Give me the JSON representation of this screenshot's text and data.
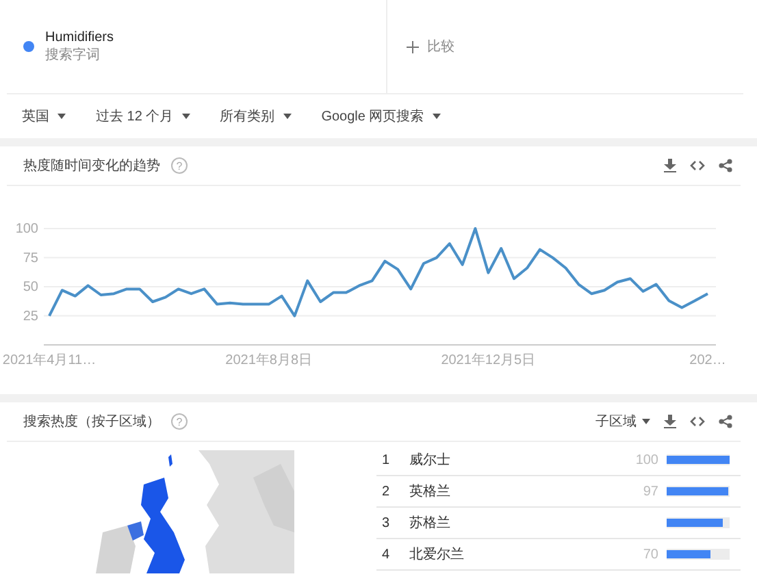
{
  "term": {
    "name": "Humidifiers",
    "subtitle": "搜索字词",
    "color": "#4285f4"
  },
  "compare": {
    "label": "比较"
  },
  "filters": [
    {
      "label": "英国"
    },
    {
      "label": "过去 12 个月"
    },
    {
      "label": "所有类别"
    },
    {
      "label": "Google 网页搜索"
    }
  ],
  "interest_over_time": {
    "title": "热度随时间变化的趋势",
    "help": "?",
    "chart_data": {
      "type": "line",
      "categories": [
        "2021年4月11…",
        null,
        null,
        null,
        null,
        null,
        null,
        null,
        null,
        null,
        null,
        null,
        null,
        null,
        null,
        null,
        null,
        "2021年8月8日",
        null,
        null,
        null,
        null,
        null,
        null,
        null,
        null,
        null,
        null,
        null,
        null,
        null,
        null,
        null,
        null,
        "2021年12月5日",
        null,
        null,
        null,
        null,
        null,
        null,
        null,
        null,
        null,
        null,
        null,
        null,
        null,
        null,
        null,
        null,
        "202…"
      ],
      "series": [
        {
          "color": "#4a90c8",
          "values": [
            25,
            47,
            42,
            51,
            43,
            44,
            48,
            48,
            37,
            41,
            48,
            44,
            48,
            35,
            36,
            35,
            35,
            35,
            42,
            25,
            55,
            37,
            45,
            45,
            51,
            55,
            72,
            65,
            48,
            70,
            75,
            87,
            69,
            100,
            62,
            83,
            57,
            66,
            82,
            75,
            66,
            52,
            44,
            47,
            54,
            57,
            46,
            52,
            38,
            32,
            38,
            44
          ]
        }
      ],
      "ylim": [
        0,
        100
      ],
      "yticks": [
        25,
        50,
        75,
        100
      ],
      "grid": true
    }
  },
  "interest_by_region": {
    "title": "搜索热度（按子区域）",
    "help": "?",
    "resolution": "子区域",
    "rows": [
      {
        "rank": "1",
        "name": "威尔士",
        "value": "100",
        "level": 1.0
      },
      {
        "rank": "2",
        "name": "英格兰",
        "value": "97",
        "level": 0.97
      },
      {
        "rank": "3",
        "name": "苏格兰",
        "level": 0.9
      },
      {
        "rank": "4",
        "name": "北爱尔兰",
        "value": "70",
        "level": 0.7
      }
    ]
  }
}
